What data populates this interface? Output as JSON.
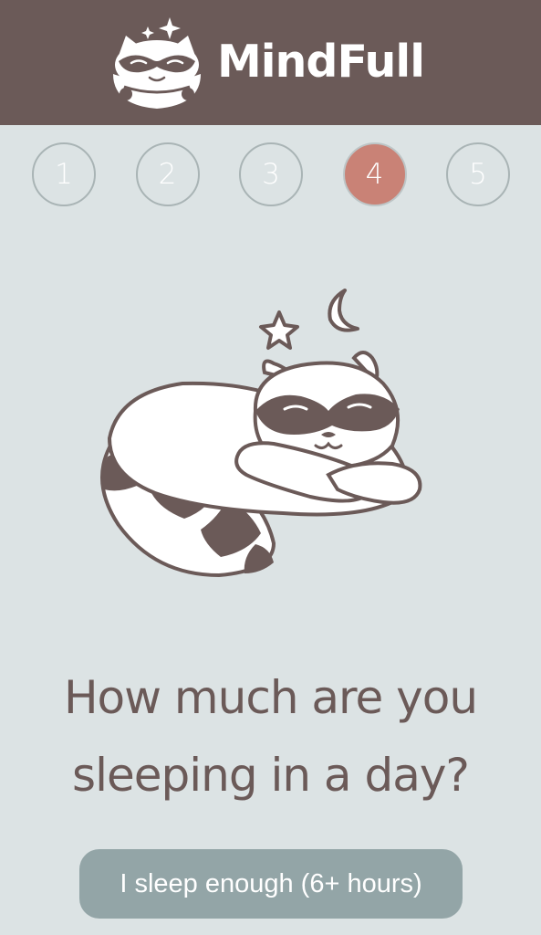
{
  "header": {
    "app_title": "MindFull",
    "logo_icon": "raccoon-logo-icon"
  },
  "steps": [
    {
      "label": "1",
      "active": false
    },
    {
      "label": "2",
      "active": false
    },
    {
      "label": "3",
      "active": false
    },
    {
      "label": "4",
      "active": true
    },
    {
      "label": "5",
      "active": false
    }
  ],
  "illustration": {
    "icon": "sleeping-raccoon-icon"
  },
  "question": {
    "line1": "How much are you",
    "line2": "sleeping in a day?"
  },
  "answer": {
    "label": "I sleep enough (6+ hours)"
  },
  "colors": {
    "header_bg": "#6b5a58",
    "page_bg": "#dce3e4",
    "active_step": "#c98276",
    "button_bg": "#93a5a7",
    "text": "#6b5a58"
  }
}
